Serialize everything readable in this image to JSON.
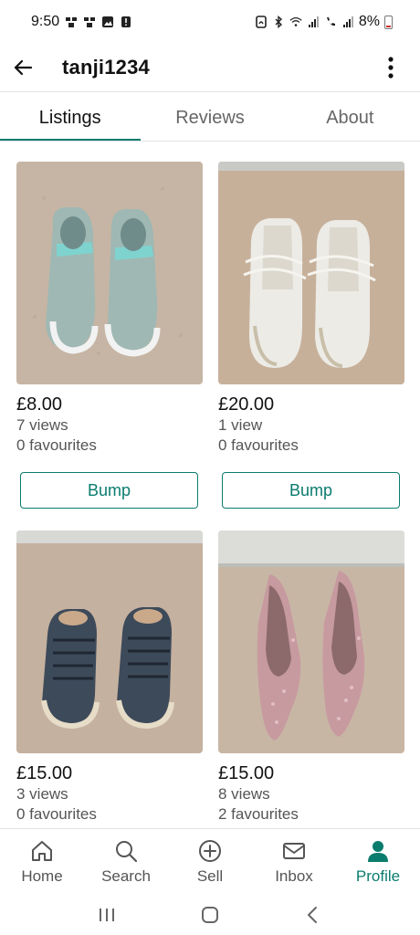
{
  "status_bar": {
    "time": "9:50",
    "battery": "8%"
  },
  "app_bar": {
    "title": "tanji1234"
  },
  "tabs": [
    {
      "label": "Listings",
      "active": true
    },
    {
      "label": "Reviews",
      "active": false
    },
    {
      "label": "About",
      "active": false
    }
  ],
  "listings": [
    {
      "price": "£8.00",
      "views": "7 views",
      "favourites": "0 favourites",
      "bump_label": "Bump"
    },
    {
      "price": "£20.00",
      "views": "1 view",
      "favourites": "0 favourites",
      "bump_label": "Bump"
    },
    {
      "price": "£15.00",
      "views": "3 views",
      "favourites": "0 favourites"
    },
    {
      "price": "£15.00",
      "views": "8 views",
      "favourites": "2 favourites"
    }
  ],
  "bottom_nav": [
    {
      "label": "Home",
      "icon": "home-icon"
    },
    {
      "label": "Search",
      "icon": "search-icon"
    },
    {
      "label": "Sell",
      "icon": "plus-circle-icon"
    },
    {
      "label": "Inbox",
      "icon": "mail-icon"
    },
    {
      "label": "Profile",
      "icon": "person-icon",
      "active": true
    }
  ],
  "colors": {
    "accent": "#0a7c6e",
    "text": "#111111",
    "muted": "#555555"
  }
}
